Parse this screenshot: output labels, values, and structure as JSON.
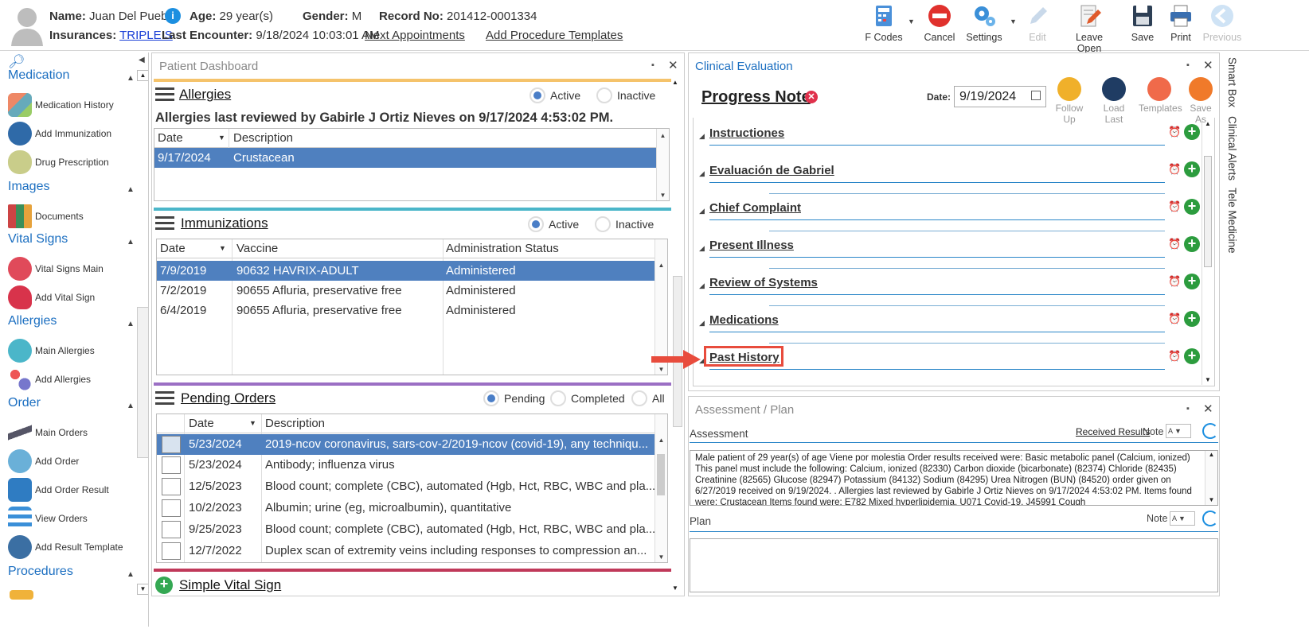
{
  "header": {
    "name_label": "Name:",
    "name": "Juan Del Pueblo",
    "age_label": "Age:",
    "age": "29 year(s)",
    "gender_label": "Gender:",
    "gender": "M",
    "record_label": "Record No:",
    "record": "201412-0001334",
    "ins_label": "Insurances:",
    "insurance": "TRIPLE S",
    "last_label": "Last Encounter:",
    "last_encounter": "9/18/2024 10:03:01 AM",
    "next_appt": "Next Appointments",
    "add_proc": "Add Procedure Templates"
  },
  "toolbar": {
    "fcodes": "F Codes",
    "cancel": "Cancel",
    "settings": "Settings",
    "edit": "Edit",
    "leave_open": "Leave Open",
    "save": "Save",
    "print": "Print",
    "previous": "Previous"
  },
  "sidebar": {
    "sections": {
      "medication": "Medication",
      "images": "Images",
      "vital_signs": "Vital Signs",
      "allergies": "Allergies",
      "order": "Order",
      "procedures": "Procedures"
    },
    "items": [
      "Medication History",
      "Add Immunization",
      "Drug Prescription",
      "Documents",
      "Vital Signs Main",
      "Add Vital Sign",
      "Main Allergies",
      "Add Allergies",
      "Main Orders",
      "Add Order",
      "Add Order Result",
      "View Orders",
      "Add Result Template"
    ]
  },
  "dashboard": {
    "title": "Patient Dashboard",
    "allergies": {
      "title": "Allergies",
      "active": "Active",
      "inactive": "Inactive",
      "reviewed": "Allergies last reviewed by Gabirle J Ortiz Nieves on 9/17/2024 4:53:02 PM.",
      "col_date": "Date",
      "col_desc": "Description",
      "rows": [
        {
          "date": "9/17/2024",
          "desc": "Crustacean"
        }
      ]
    },
    "immunizations": {
      "title": "Immunizations",
      "active": "Active",
      "inactive": "Inactive",
      "col_date": "Date",
      "col_vaccine": "Vaccine",
      "col_status": "Administration Status",
      "rows": [
        {
          "date": "7/9/2019",
          "vaccine": "90632 HAVRIX-ADULT",
          "status": "Administered"
        },
        {
          "date": "7/2/2019",
          "vaccine": "90655 Afluria, preservative free",
          "status": "Administered"
        },
        {
          "date": "6/4/2019",
          "vaccine": "90655 Afluria, preservative free",
          "status": "Administered"
        }
      ]
    },
    "orders": {
      "title": "Pending Orders",
      "pending": "Pending",
      "completed": "Completed",
      "all": "All",
      "col_date": "Date",
      "col_desc": "Description",
      "rows": [
        {
          "date": "5/23/2024",
          "desc": "2019-ncov coronavirus, sars-cov-2/2019-ncov (covid-19), any techniqu..."
        },
        {
          "date": "5/23/2024",
          "desc": "Antibody; influenza virus"
        },
        {
          "date": "12/5/2023",
          "desc": "Blood count; complete (CBC), automated (Hgb, Hct, RBC, WBC and pla..."
        },
        {
          "date": "10/2/2023",
          "desc": "Albumin; urine (eg, microalbumin), quantitative"
        },
        {
          "date": "9/25/2023",
          "desc": "Blood count; complete (CBC), automated (Hgb, Hct, RBC, WBC and pla..."
        },
        {
          "date": "12/7/2022",
          "desc": "Duplex scan of extremity veins including responses to compression an..."
        }
      ]
    },
    "simple_vital": "Simple Vital Sign"
  },
  "clinical": {
    "title": "Clinical Evaluation",
    "note_title": "Progress Note",
    "date_label": "Date:",
    "date": "9/19/2024",
    "buttons": {
      "follow_up": "Follow Up",
      "load_last": "Load Last",
      "templates": "Templates",
      "save_as": "Save As"
    },
    "sections": [
      "Instructiones",
      "Evaluación de Gabriel",
      "Chief Complaint",
      "Present Illness",
      "Review of Systems",
      "Medications",
      "Past History"
    ]
  },
  "assessment": {
    "title": "Assessment / Plan",
    "assessment_label": "Assessment",
    "received_results": "Received Results",
    "note": "Note",
    "plan_label": "Plan",
    "text": "Male patient of 29 year(s) of age Viene por molestia   Order results received were: Basic metabolic panel (Calcium, ionized) This panel must include the following: Calcium, ionized (82330) Carbon dioxide (bicarbonate) (82374) Chloride (82435) Creatinine (82565) Glucose (82947) Potassium (84132) Sodium (84295) Urea Nitrogen (BUN) (84520) order given on 6/27/2019 received on 9/19/2024. .  Allergies last reviewed by Gabirle J Ortiz Nieves on 9/17/2024 4:53:02 PM.    Items found were:  Crustacean  Items found were:  E782 Mixed hyperlipidemia, U071 Covid-19, J45991 Cough"
  },
  "side_tabs": [
    "Smart Box",
    "Clinical Alerts",
    "Tele Medicine"
  ],
  "colors": {
    "accent_blue": "#1c6fc1",
    "selected_row": "#4f80bf",
    "allergy_bar": "#f5c36b",
    "immun_bar": "#4bb6c9",
    "orders_bar": "#9b6fc4",
    "vital_bar": "#c0395a",
    "highlight": "#e84c3d"
  }
}
